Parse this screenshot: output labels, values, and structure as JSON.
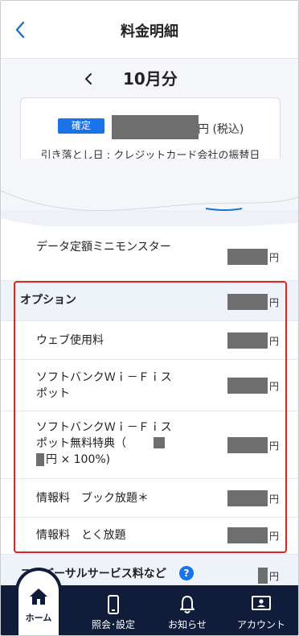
{
  "header": {
    "title": "料金明細",
    "back_icon": "chevron-left-icon"
  },
  "summary": {
    "prev_icon": "chevron-left-icon",
    "month": "10月分",
    "status_badge": "確定",
    "unit": "円 (税込)",
    "debit_date": "引き落とし日 : クレジットカード会社の振替日"
  },
  "items": [
    {
      "label": "データ定額ミニモンスター",
      "unit": "円"
    },
    {
      "label": "オプション",
      "unit": "円"
    },
    {
      "label": "ウェブ使用料",
      "unit": "円"
    },
    {
      "label": "ソフトバンクＷｉ－Ｆｉスポット",
      "unit": "円"
    },
    {
      "label_a": "ソフトバンクＷｉ－Ｆｉスポット無料特典（",
      "label_b": "円 × 100%)",
      "unit": "円"
    },
    {
      "label": "情報料　ブック放題＊",
      "unit": "円"
    },
    {
      "label": "情報料　とく放題",
      "unit": "円"
    },
    {
      "label": "ユニバーサルサービス料など",
      "unit": "円"
    }
  ],
  "help_icon": "help-icon",
  "nav": {
    "home": "ホーム",
    "settings": "照会･設定",
    "notifications": "お知らせ",
    "account": "アカウント"
  },
  "colors": {
    "accent": "#1a73e8",
    "nav_bg": "#0f1d3a",
    "highlight_border": "#e0261b",
    "mask": "#6e6e6e"
  }
}
